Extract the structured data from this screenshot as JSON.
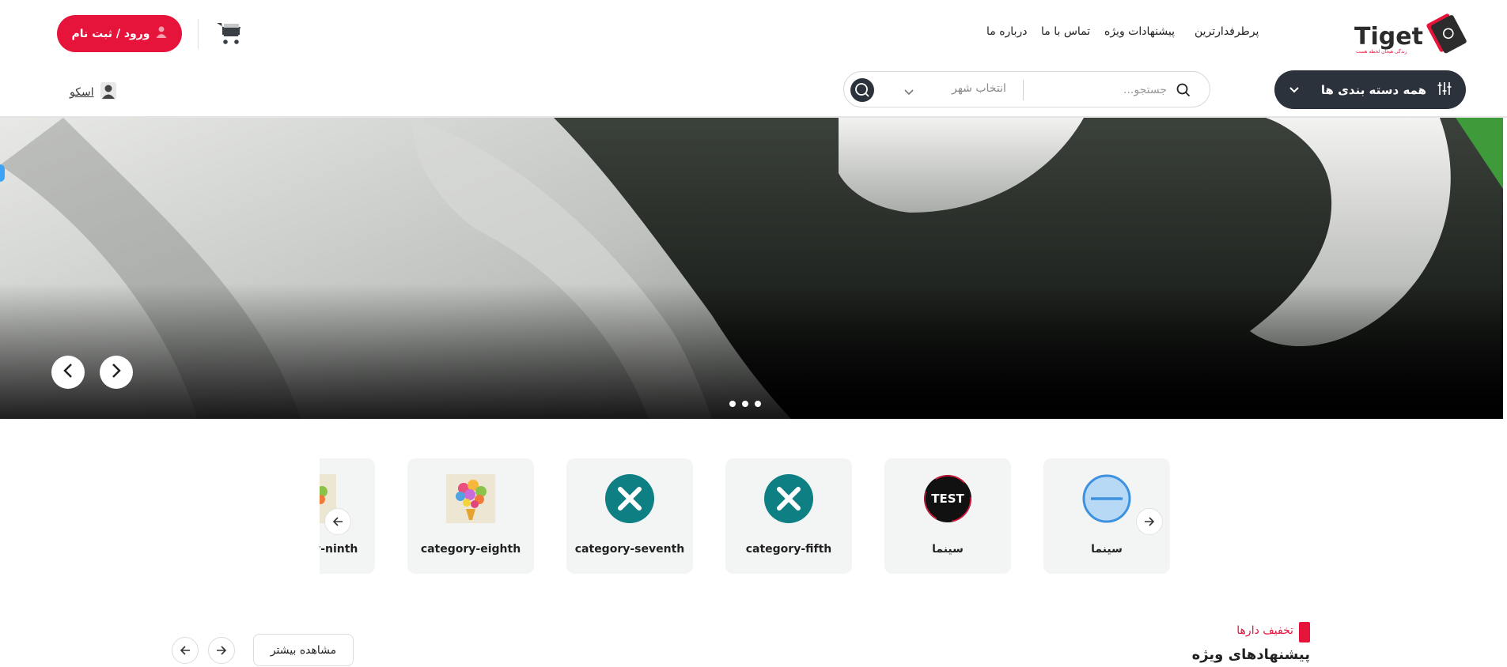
{
  "brand": {
    "logo_text": "Tiget",
    "logo_tagline": "زندگی هیجان لحظه هست"
  },
  "nav": {
    "links": [
      {
        "label": "پرطرفدارترین"
      },
      {
        "label": "پیشنهادات ویژه"
      },
      {
        "label": "تماس با ما"
      },
      {
        "label": "درباره ما"
      }
    ]
  },
  "header": {
    "login_label": "ورود / ثبت نام",
    "categories_label": "همه دسته بندی ها",
    "search_placeholder": "جستجو...",
    "city_label": "انتخاب شهر",
    "user_name": "اسکو"
  },
  "hero": {
    "slides": 3,
    "active_slide": 3
  },
  "categories": [
    {
      "label": "سینما",
      "icon": "minus-circle-icon"
    },
    {
      "label": "سینما",
      "icon": "test-logo-icon"
    },
    {
      "label": "category-fifth",
      "icon": "x-circle-icon"
    },
    {
      "label": "category-seventh",
      "icon": "x-circle-icon"
    },
    {
      "label": "category-eighth",
      "icon": "flower-bouquet-icon"
    },
    {
      "label": "category-ninth",
      "icon": "flower-bouquet-icon"
    }
  ],
  "offers": {
    "subtitle": "تخفیف دارها",
    "title": "پیشنهادهای ویژه",
    "see_more_label": "مشاهده بیشتر"
  },
  "colors": {
    "accent": "#e6133b",
    "dark": "#2c323b",
    "teal": "#0e7f83",
    "card_bg": "#f3f4f4"
  }
}
